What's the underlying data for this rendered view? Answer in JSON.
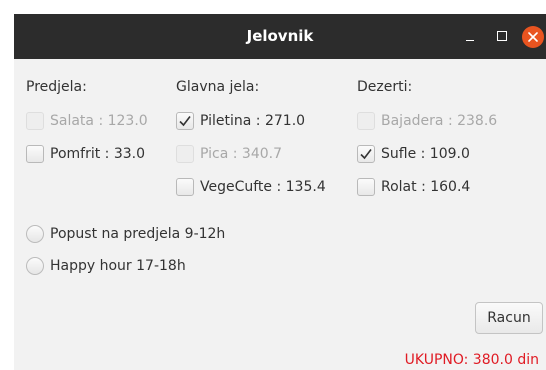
{
  "window": {
    "title": "Jelovnik",
    "controls": [
      "minimize-icon",
      "maximize-icon",
      "close-icon"
    ]
  },
  "columns": {
    "appetizers": {
      "header": "Predjela:",
      "items": [
        {
          "label": "Salata : 123.0",
          "checked": false,
          "enabled": false
        },
        {
          "label": "Pomfrit : 33.0",
          "checked": false,
          "enabled": true
        }
      ]
    },
    "mains": {
      "header": "Glavna jela:",
      "items": [
        {
          "label": "Piletina : 271.0",
          "checked": true,
          "enabled": true
        },
        {
          "label": "Pica : 340.7",
          "checked": false,
          "enabled": false
        },
        {
          "label": "VegeCufte : 135.4",
          "checked": false,
          "enabled": true
        }
      ]
    },
    "desserts": {
      "header": "Dezerti:",
      "items": [
        {
          "label": "Bajadera : 238.6",
          "checked": false,
          "enabled": false
        },
        {
          "label": "Sufle : 109.0",
          "checked": true,
          "enabled": true
        },
        {
          "label": "Rolat : 160.4",
          "checked": false,
          "enabled": true
        }
      ]
    }
  },
  "discounts": [
    {
      "label": "Popust na predjela 9-12h",
      "selected": false
    },
    {
      "label": "Happy hour 17-18h",
      "selected": false
    }
  ],
  "button": {
    "label": "Racun"
  },
  "total": {
    "text": "UKUPNO: 380.0 din",
    "color": "#e01b24"
  },
  "colors": {
    "titlebar": "#2c2c2c",
    "close_button": "#e95420",
    "background": "#f2f2f2"
  }
}
